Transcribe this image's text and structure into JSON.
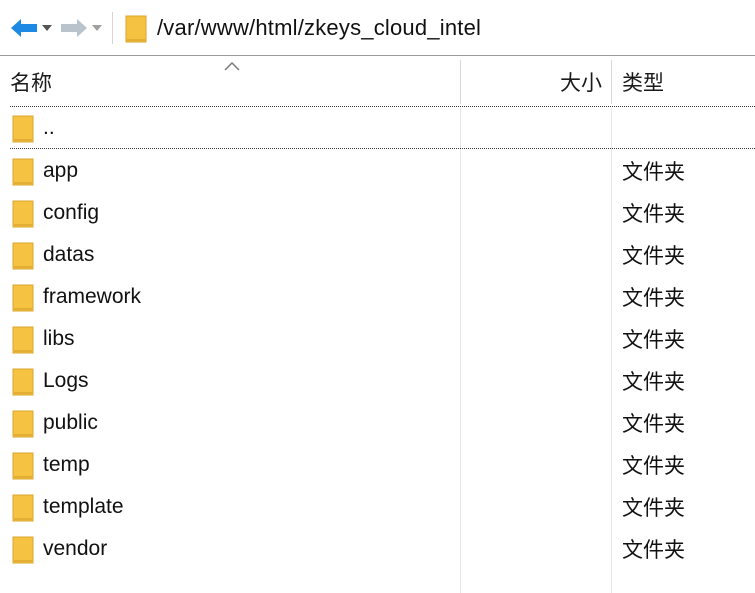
{
  "path_bar": {
    "path": "/var/www/html/zkeys_cloud_intel",
    "colors": {
      "back_arrow": "#1e88e5",
      "forward_arrow": "#b9c3cc",
      "folder": "#f5c242"
    }
  },
  "columns": {
    "name": "名称",
    "size": "大小",
    "type": "类型",
    "sorted_by": "name"
  },
  "parent_entry": {
    "name": ".."
  },
  "files": [
    {
      "name": "app",
      "size": "",
      "type": "文件夹"
    },
    {
      "name": "config",
      "size": "",
      "type": "文件夹"
    },
    {
      "name": "datas",
      "size": "",
      "type": "文件夹"
    },
    {
      "name": "framework",
      "size": "",
      "type": "文件夹"
    },
    {
      "name": "libs",
      "size": "",
      "type": "文件夹"
    },
    {
      "name": "Logs",
      "size": "",
      "type": "文件夹"
    },
    {
      "name": "public",
      "size": "",
      "type": "文件夹"
    },
    {
      "name": "temp",
      "size": "",
      "type": "文件夹"
    },
    {
      "name": "template",
      "size": "",
      "type": "文件夹"
    },
    {
      "name": "vendor",
      "size": "",
      "type": "文件夹"
    }
  ]
}
